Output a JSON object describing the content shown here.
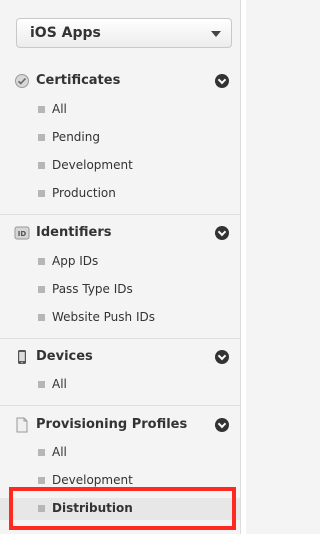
{
  "selector": {
    "label": "iOS Apps"
  },
  "sections": [
    {
      "title": "Certificates",
      "items": [
        "All",
        "Pending",
        "Development",
        "Production"
      ]
    },
    {
      "title": "Identifiers",
      "icon_text": "ID",
      "items": [
        "App IDs",
        "Pass Type IDs",
        "Website Push IDs"
      ]
    },
    {
      "title": "Devices",
      "items": [
        "All"
      ]
    },
    {
      "title": "Provisioning Profiles",
      "items": [
        "All",
        "Development",
        "Distribution"
      ]
    }
  ],
  "selected_item": "Distribution",
  "colors": {
    "highlight": "#ff2a1f",
    "background": "#f4f4f4"
  }
}
